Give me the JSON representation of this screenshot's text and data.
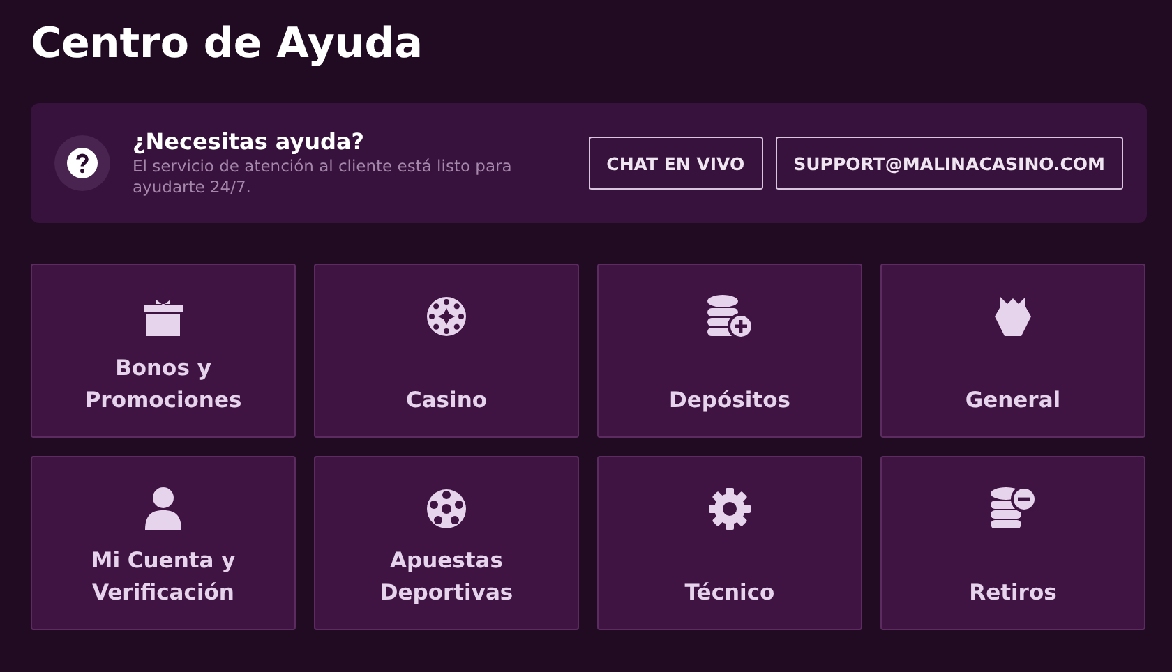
{
  "title": "Centro de Ayuda",
  "help_banner": {
    "heading": "¿Necesitas ayuda?",
    "text": "El servicio de atención al cliente está listo para ayudarte 24/7.",
    "buttons": [
      "CHAT EN VIVO",
      "SUPPORT@MALINACASINO.COM"
    ]
  },
  "categories": [
    {
      "label": "Bonos y Promociones",
      "kind": "gift"
    },
    {
      "label": "Casino",
      "kind": "chip"
    },
    {
      "label": "Depósitos",
      "kind": "coins-plus"
    },
    {
      "label": "General",
      "kind": "crest"
    },
    {
      "label": "Mi Cuenta y Verificación",
      "kind": "user"
    },
    {
      "label": "Apuestas Deportivas",
      "kind": "ball"
    },
    {
      "label": "Técnico",
      "kind": "gear"
    },
    {
      "label": "Retiros",
      "kind": "coins-minus"
    }
  ]
}
